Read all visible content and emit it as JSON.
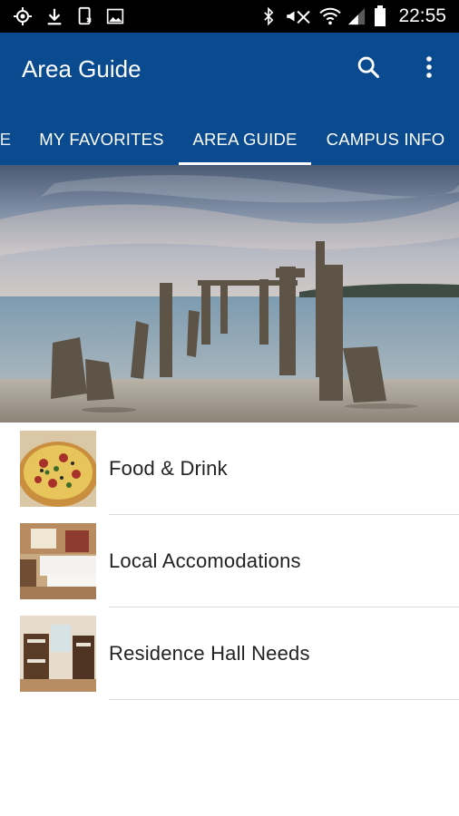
{
  "status_bar": {
    "time": "22:55",
    "icons": [
      "gps-icon",
      "download-icon",
      "phone-icon",
      "image-icon",
      "bluetooth-icon",
      "mute-icon",
      "wifi-icon",
      "signal-icon",
      "battery-icon"
    ]
  },
  "app_bar": {
    "title": "Area Guide",
    "color": "#0a4a8f",
    "actions": [
      "search-icon",
      "overflow-menu-icon"
    ]
  },
  "tabs": [
    {
      "label": "E",
      "selected": false
    },
    {
      "label": "MY FAVORITES",
      "selected": false
    },
    {
      "label": "AREA GUIDE",
      "selected": true
    },
    {
      "label": "CAMPUS INFO",
      "selected": false
    }
  ],
  "hero": {
    "icon": "pier-landscape-image"
  },
  "list": [
    {
      "label": "Food & Drink",
      "icon": "pizza-image"
    },
    {
      "label": "Local Accomodations",
      "icon": "hotel-room-image"
    },
    {
      "label": "Residence Hall Needs",
      "icon": "dorm-room-image"
    }
  ]
}
